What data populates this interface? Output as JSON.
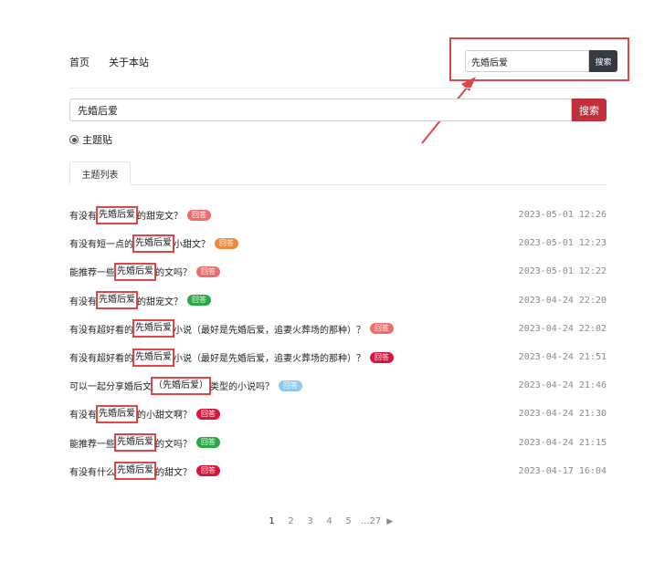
{
  "nav": {
    "home": "首页",
    "about": "关于本站"
  },
  "top_search": {
    "value": "先婚后爱",
    "button": "搜索"
  },
  "main_search": {
    "value": "先婚后爱",
    "button": "搜索"
  },
  "filter": {
    "label": "主题贴",
    "selected": true
  },
  "tab": {
    "label": "主题列表"
  },
  "colors": {
    "red": "#e04646",
    "orange": "#f0883a",
    "green": "#28a745",
    "light_red": "#f06b6b",
    "crimson": "#dc143c",
    "light_blue": "#8ec8f5",
    "dark": "#343a40",
    "search_red": "#c0303b"
  },
  "topics": [
    {
      "pre": "有没有",
      "hl": "先婚后爱",
      "post": "的甜宠文？",
      "badge": "回答",
      "badge_color": "#f06b6b",
      "time": "2023-05-01 12:26"
    },
    {
      "pre": "有没有短一点的",
      "hl": "先婚后爱",
      "post": "小甜文？",
      "badge": "回答",
      "badge_color": "#f0883a",
      "time": "2023-05-01 12:23"
    },
    {
      "pre": "能推荐一些",
      "hl": "先婚后爱",
      "post": "的文吗？",
      "badge": "回答",
      "badge_color": "#f06b6b",
      "time": "2023-05-01 12:22"
    },
    {
      "pre": "有没有",
      "hl": "先婚后爱",
      "post": "的甜宠文？",
      "badge": "回答",
      "badge_color": "#28a745",
      "time": "2023-04-24 22:20"
    },
    {
      "pre": "有没有超好看的",
      "hl": "先婚后爱",
      "post": "小说（最好是先婚后爱，追妻火葬场的那种）？",
      "badge": "回答",
      "badge_color": "#f06b6b",
      "time": "2023-04-24 22:02"
    },
    {
      "pre": "有没有超好看的",
      "hl": "先婚后爱",
      "post": "小说（最好是先婚后爱，追妻火葬场的那种）？",
      "badge": "回答",
      "badge_color": "#dc143c",
      "time": "2023-04-24 21:51"
    },
    {
      "pre": "可以一起分享婚后文",
      "hl": "（先婚后爱）",
      "post": "类型的小说吗？",
      "badge": "回答",
      "badge_color": "#8ec8f5",
      "time": "2023-04-24 21:46"
    },
    {
      "pre": "有没有",
      "hl": "先婚后爱",
      "post": "的小甜文啊？",
      "badge": "回答",
      "badge_color": "#dc143c",
      "time": "2023-04-24 21:30"
    },
    {
      "pre": "能推荐一些",
      "hl": "先婚后爱",
      "post": "的文吗？",
      "badge": "回答",
      "badge_color": "#28a745",
      "time": "2023-04-24 21:15"
    },
    {
      "pre": "有没有什么",
      "hl": "先婚后爱",
      "post": "的甜文？",
      "badge": "回答",
      "badge_color": "#dc143c",
      "time": "2023-04-17 16:04"
    }
  ],
  "pagination": {
    "pages": [
      "1",
      "2",
      "3",
      "4",
      "5"
    ],
    "ellipsis": "...27",
    "current": "1",
    "next_icon": "play-right-icon"
  }
}
